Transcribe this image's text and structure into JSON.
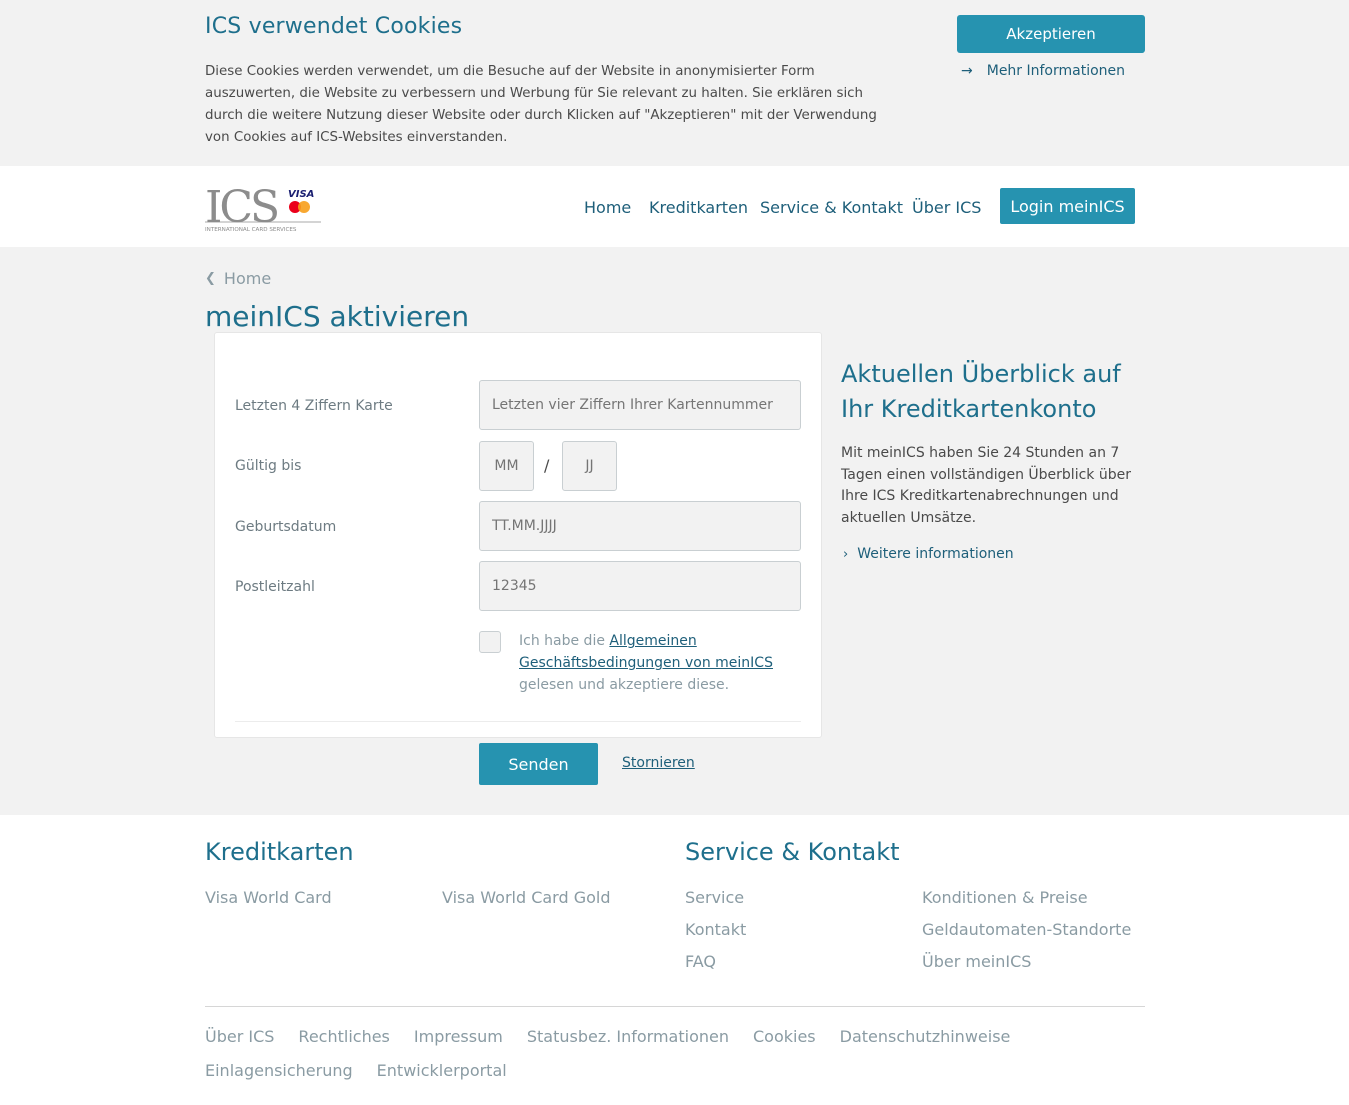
{
  "cookie_banner": {
    "title": "ICS verwendet Cookies",
    "text": "Diese Cookies werden verwendet, um die Besuche auf der Website in anonymisierter Form auszuwerten, die Website zu verbessern und Werbung für Sie relevant zu halten. Sie erklären sich durch die weitere Nutzung dieser Website oder durch Klicken auf \"Akzeptieren\" mit der Verwendung von Cookies auf ICS-Websites einverstanden.",
    "accept_label": "Akzeptieren",
    "more_info_label": "Mehr Informationen"
  },
  "header": {
    "logo": {
      "letters": "ICS",
      "tagline": "INTERNATIONAL CARD SERVICES",
      "visa": "VISA",
      "mastercard": "MasterCard"
    },
    "nav": [
      "Home",
      "Kreditkarten",
      "Service & Kontakt",
      "Über ICS"
    ],
    "login_label": "Login meinICS"
  },
  "breadcrumb": "Home",
  "page_title": "meinICS aktivieren",
  "form": {
    "card_digits": {
      "label": "Letzten 4 Ziffern Karte",
      "placeholder": "Letzten vier Ziffern Ihrer Kartennummer"
    },
    "valid_until": {
      "label": "Gültig bis",
      "month_placeholder": "MM",
      "separator": "/",
      "year_placeholder": "JJ"
    },
    "birth_date": {
      "label": "Geburtsdatum",
      "placeholder": "TT.MM.JJJJ"
    },
    "postal_code": {
      "label": "Postleitzahl",
      "placeholder": "12345"
    },
    "terms": {
      "prefix": "Ich habe die ",
      "link": "Allgemeinen Geschäftsbedingungen von meinICS",
      "suffix": " gelesen und akzeptiere diese."
    },
    "submit_label": "Senden",
    "cancel_label": "Stornieren"
  },
  "sidebar": {
    "title": "Aktuellen Überblick auf Ihr Kreditkartenkonto",
    "text": "Mit meinICS haben Sie 24 Stunden an 7 Tagen einen vollständigen Überblick über Ihre ICS Kreditkartenabrechnungen und aktuellen Umsätze.",
    "link_label": "Weitere informationen"
  },
  "footer": {
    "kreditkarten": {
      "heading": "Kreditkarten",
      "links": [
        "Visa World Card",
        "Visa World Card Gold"
      ]
    },
    "service": {
      "heading": "Service & Kontakt",
      "col1": [
        "Service",
        "Kontakt",
        "FAQ"
      ],
      "col2": [
        "Konditionen & Preise",
        "Geldautomaten-Standorte",
        "Über meinICS"
      ]
    },
    "bottom_links": [
      "Über ICS",
      "Rechtliches",
      "Impressum",
      "Statusbez. Informationen",
      "Cookies",
      "Datenschutzhinweise",
      "Einlagensicherung",
      "Entwicklerportal"
    ]
  },
  "colors": {
    "accent": "#2693b0",
    "heading": "#1e6f8c",
    "link": "#1e5f7a",
    "background_gray": "#f2f2f2"
  }
}
